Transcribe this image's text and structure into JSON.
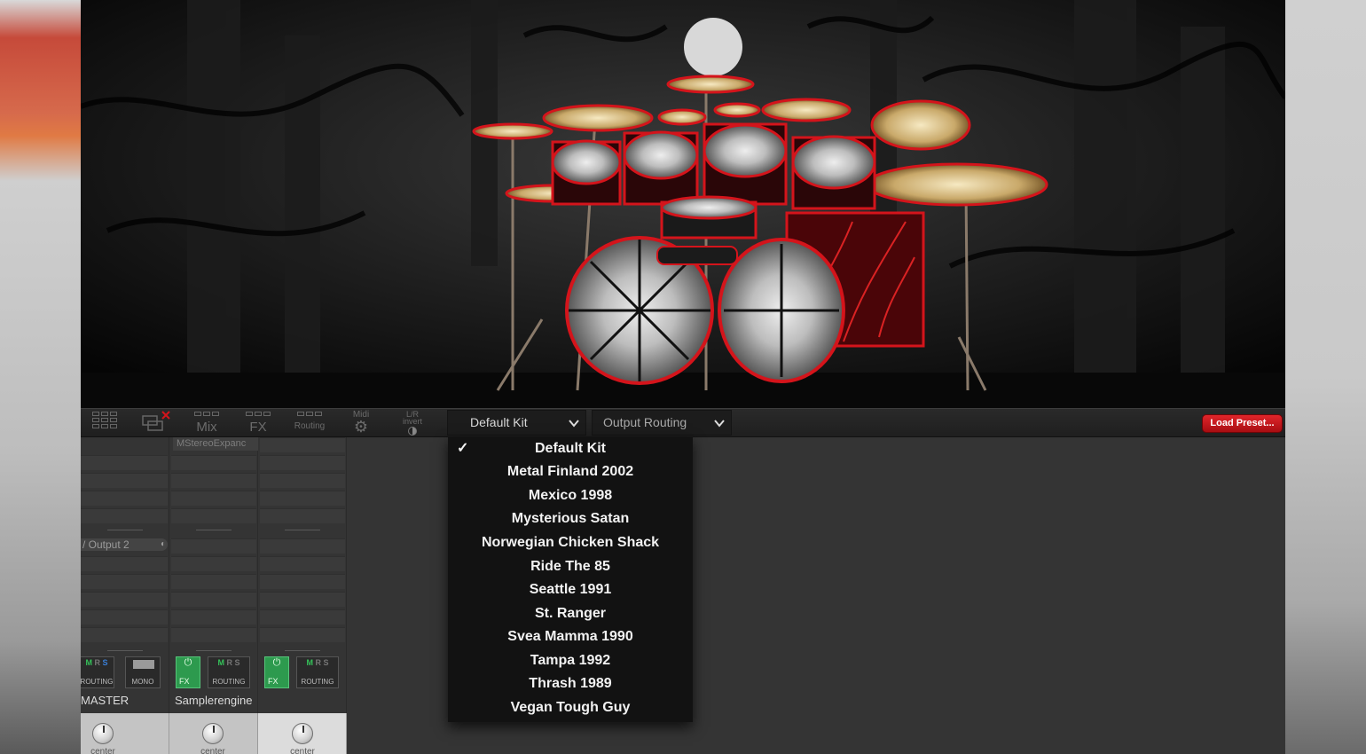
{
  "toolbar": {
    "mix_label": "Mix",
    "fx_label": "FX",
    "routing_label": "Routing",
    "midi_label": "Midi",
    "lr_label": "L/R",
    "invert_label": "invert",
    "kit_dropdown": "Default Kit",
    "output_dropdown": "Output Routing",
    "load_preset": "Load Preset..."
  },
  "mixer": {
    "plugin_slot": "MStereoExpanc",
    "output_field": "/ Output 2",
    "strips": [
      {
        "name": "MASTER",
        "msr": "M R S",
        "btn1": "ROUTING",
        "btn2": "MONO",
        "pan": "center"
      },
      {
        "name": "Samplerengine",
        "fx": "FX",
        "msr": "M R S",
        "btn2": "ROUTING",
        "pan": "center"
      },
      {
        "name": "",
        "fx": "FX",
        "msr": "M R S",
        "btn2": "ROUTING",
        "pan": "center"
      }
    ]
  },
  "menu": {
    "selected": "Default Kit",
    "items": [
      "Default Kit",
      "Metal Finland 2002",
      "Mexico 1998",
      "Mysterious Satan",
      "Norwegian Chicken Shack",
      "Ride The 85",
      "Seattle 1991",
      "St. Ranger",
      "Svea Mamma 1990",
      "Tampa 1992",
      "Thrash 1989",
      "Vegan Tough Guy"
    ]
  },
  "colors": {
    "accent_red": "#d4141b",
    "fx_green": "#2d9a4e",
    "menu_bg": "#121212"
  }
}
